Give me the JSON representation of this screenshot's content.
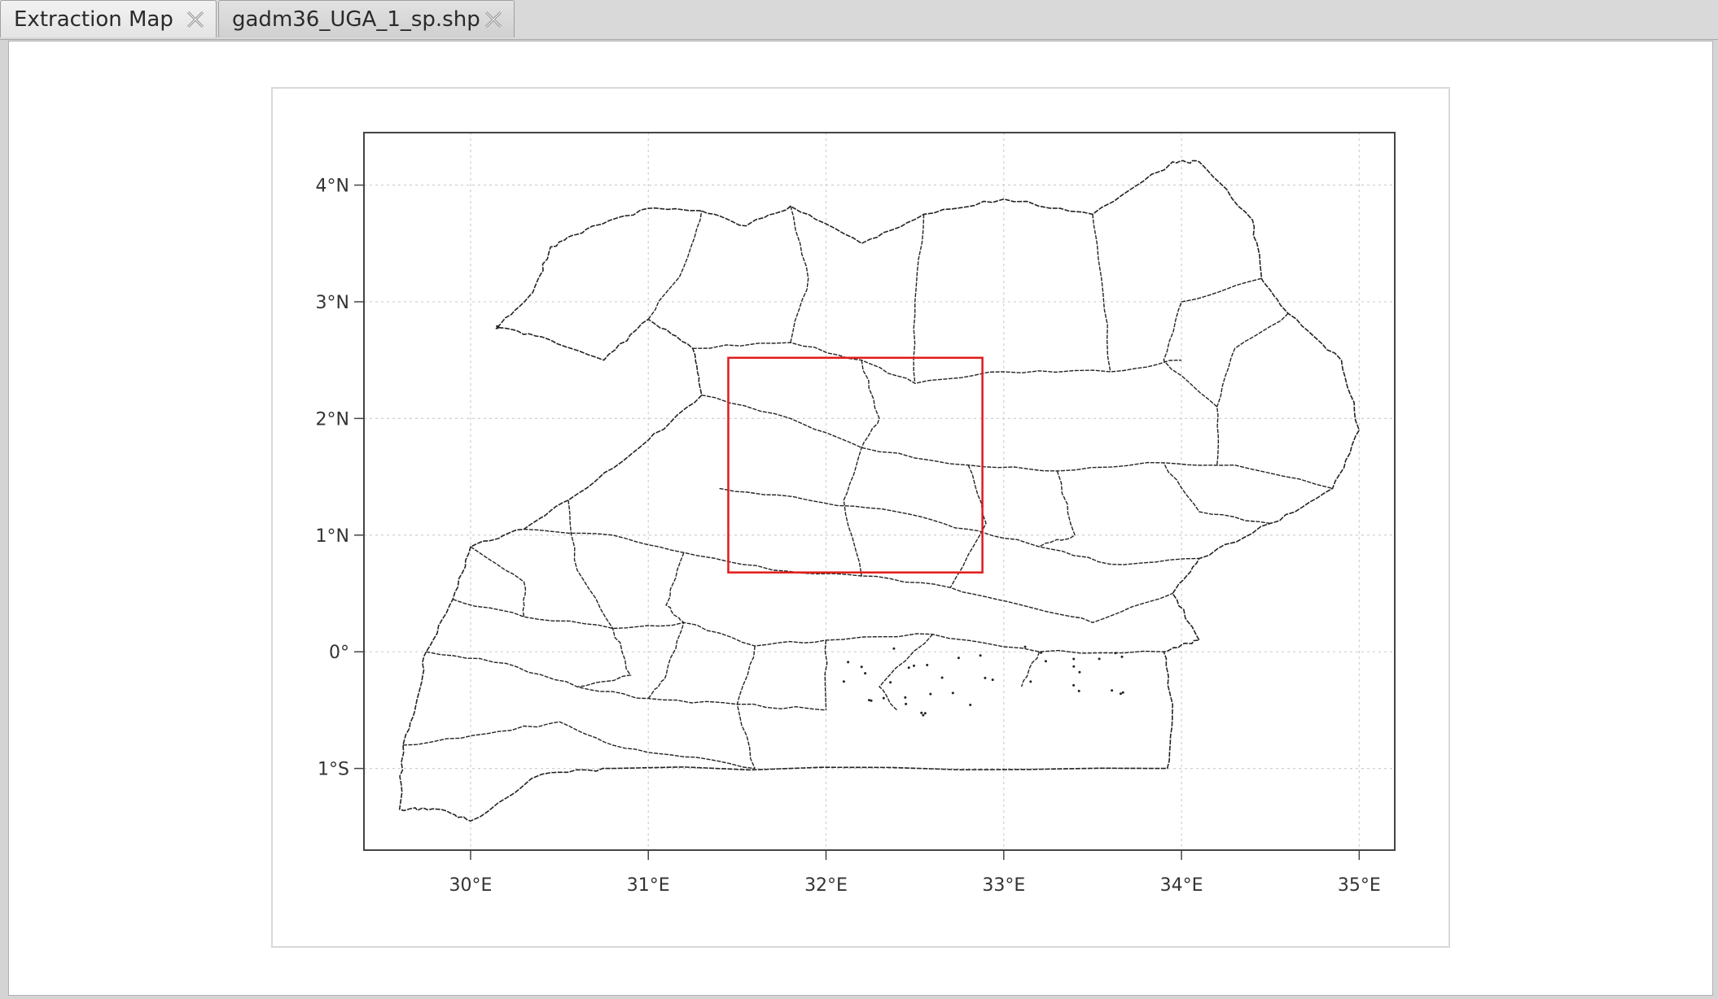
{
  "tabs": [
    {
      "label": "Extraction Map",
      "active": true
    },
    {
      "label": "gadm36_UGA_1_sp.shp",
      "active": false
    }
  ],
  "map": {
    "x_ticks": [
      "30°E",
      "31°E",
      "32°E",
      "33°E",
      "34°E",
      "35°E"
    ],
    "y_ticks": [
      "4°N",
      "3°N",
      "2°N",
      "1°N",
      "0°",
      "1°S"
    ],
    "extent": {
      "lon_min": 29.4,
      "lon_max": 35.2,
      "lat_min": -1.7,
      "lat_max": 4.45
    },
    "selection_box": {
      "lon_min": 31.45,
      "lon_max": 32.88,
      "lat_min": 0.68,
      "lat_max": 2.52
    },
    "colors": {
      "boundary": "#222222",
      "selection": "#e11a1a",
      "grid": "#cfcfcf"
    }
  }
}
